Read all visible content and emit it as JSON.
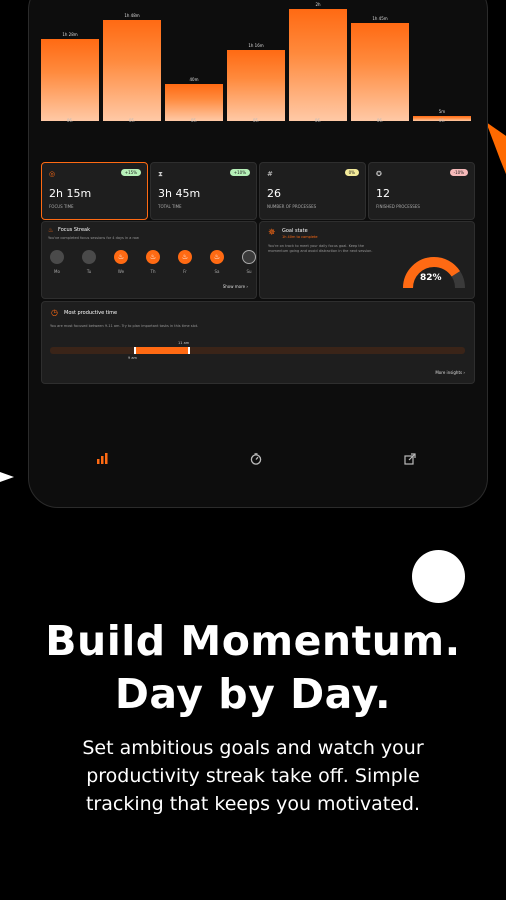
{
  "chart_data": {
    "type": "bar",
    "categories": [
      "06.",
      "05.",
      "05.",
      "05.",
      "06.",
      "06.",
      "06."
    ],
    "value_labels": [
      "1h 28m",
      "1h 48m",
      "40m",
      "1h 16m",
      "2h",
      "1h 45m",
      "5m"
    ],
    "values": [
      88,
      108,
      40,
      76,
      120,
      105,
      5
    ],
    "ylim": [
      0,
      120
    ]
  },
  "stats": [
    {
      "icon": "focus-icon",
      "value": "2h 15m",
      "label": "FOCUS TIME",
      "badge": "+15%",
      "badge_color": "#b6f0b8"
    },
    {
      "icon": "hourglass-icon",
      "value": "3h 45m",
      "label": "TOTAL TIME",
      "badge": "+10%",
      "badge_color": "#b6f0b8"
    },
    {
      "icon": "hash-icon",
      "value": "26",
      "label": "NUMBER OF PROCESSES",
      "badge": "0%",
      "badge_color": "#f3ea9a"
    },
    {
      "icon": "check-badge-icon",
      "value": "12",
      "label": "FINISHED PROCESSES",
      "badge": "-10%",
      "badge_color": "#f6b9b9"
    }
  ],
  "streak": {
    "title": "Focus Streak",
    "text": "You've completed focus sessions for 4 days in a row",
    "days": [
      {
        "label": "Mo",
        "state": "off"
      },
      {
        "label": "Tu",
        "state": "off"
      },
      {
        "label": "We",
        "state": "on"
      },
      {
        "label": "Th",
        "state": "on"
      },
      {
        "label": "Fr",
        "state": "on"
      },
      {
        "label": "Sa",
        "state": "on"
      },
      {
        "label": "Su",
        "state": "today"
      }
    ],
    "show_more": "Show more"
  },
  "goal": {
    "title": "Goal state",
    "subtitle": "1h 40m to complete",
    "text": "You're on track to meet your daily focus goal. Keep the momentum going and avoid distraction in the next session.",
    "percent": "82%",
    "progress": 0.82
  },
  "productive": {
    "title": "Most productive time",
    "text": "You are most focused between 9-11 am. Try to plan important tasks in this time slot.",
    "start_label": "9 am",
    "end_label": "11 am",
    "more_insights": "More insights"
  },
  "colors": {
    "accent": "#ff6a13",
    "card": "#1e1e1e"
  },
  "tabs": [
    "bar-chart-icon",
    "timer-icon",
    "export-icon"
  ],
  "headline_line1": "Build Momentum.",
  "headline_line2": "Day by Day.",
  "sub_line1": "Set ambitious goals and watch your",
  "sub_line2": "productivity streak take off. Simple",
  "sub_line3": "tracking that keeps you motivated."
}
